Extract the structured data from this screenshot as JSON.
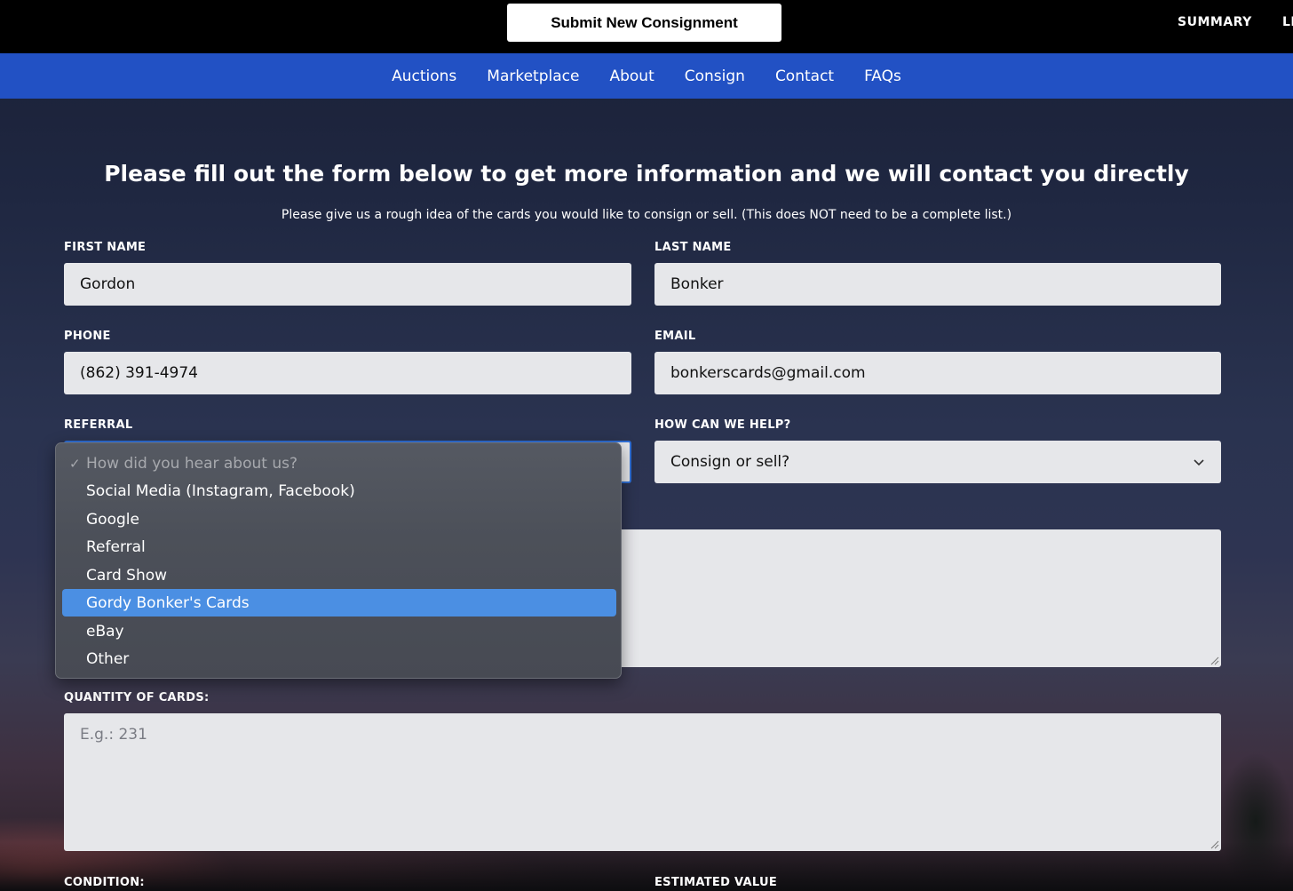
{
  "topbar": {
    "submit_label": "Submit New Consignment",
    "links": [
      "SUMMARY",
      "LI"
    ]
  },
  "nav": {
    "items": [
      "Auctions",
      "Marketplace",
      "About",
      "Consign",
      "Contact",
      "FAQs"
    ]
  },
  "form": {
    "heading": "Please fill out the form below to get more information and we will contact you directly",
    "subtitle": "Please give us a rough idea of the cards you would like to consign or sell. (This does NOT need to be a complete list.)",
    "first_name": {
      "label": "FIRST NAME",
      "value": "Gordon"
    },
    "last_name": {
      "label": "LAST NAME",
      "value": "Bonker"
    },
    "phone": {
      "label": "PHONE",
      "value": "(862) 391-4974"
    },
    "email": {
      "label": "EMAIL",
      "value": "bonkerscards@gmail.com"
    },
    "referral": {
      "label": "REFERRAL"
    },
    "help": {
      "label": "HOW CAN WE HELP?",
      "value": "Consign or sell?"
    },
    "quantity": {
      "label": "QUANTITY OF CARDS:",
      "placeholder": "E.g.: 231"
    },
    "condition": {
      "label": "CONDITION:"
    },
    "estimated_value": {
      "label": "ESTIMATED VALUE"
    }
  },
  "referral_dropdown": {
    "placeholder": "How did you hear about us?",
    "options": [
      "Social Media (Instagram, Facebook)",
      "Google",
      "Referral",
      "Card Show",
      "Gordy Bonker's Cards",
      "eBay",
      "Other"
    ],
    "selected": "Gordy Bonker's Cards"
  }
}
